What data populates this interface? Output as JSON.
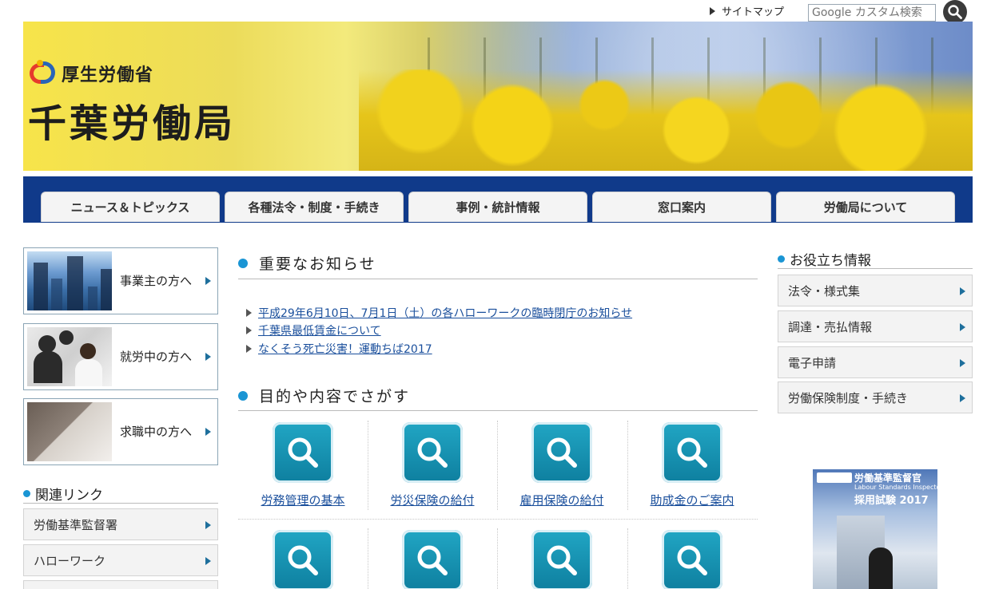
{
  "header": {
    "sitemap_label": "サイトマップ",
    "search_placeholder": "Google カスタム検索"
  },
  "banner": {
    "ministry": "厚生労働省",
    "bureau": "千葉労働局"
  },
  "nav": {
    "tabs": [
      "ニュース＆トピックス",
      "各種法令・制度・手続き",
      "事例・統計情報",
      "窓口案内",
      "労働局について"
    ]
  },
  "left": {
    "audiences": [
      "事業主の方へ",
      "就労中の方へ",
      "求職中の方へ"
    ],
    "related_heading": "関連リンク",
    "related_links": [
      "労働基準監督署",
      "ハローワーク"
    ]
  },
  "center": {
    "notice_heading": "重要なお知らせ",
    "notices": [
      "平成29年6月10日、7月1日（土）の各ハローワークの臨時閉庁のお知らせ",
      "千葉県最低賃金について",
      "なくそう死亡災害！運動ちば2017"
    ],
    "search_heading": "目的や内容でさがす",
    "search_tiles": [
      "労務管理の基本",
      "労災保険の給付",
      "雇用保険の給付",
      "助成金のご案内"
    ]
  },
  "right": {
    "useful_heading": "お役立ち情報",
    "useful_links": [
      "法令・様式集",
      "調達・売払情報",
      "電子申請",
      "労働保険制度・手続き"
    ],
    "recruit_banner": {
      "title": "労働基準監督官",
      "subtitle": "Labour Standards Inspector",
      "exam": "採用試験 2017"
    }
  },
  "colors": {
    "nav_bg": "#103a8a",
    "accent_dot": "#1a95d4",
    "link": "#1a4f9c",
    "tile": "#1392b3"
  }
}
